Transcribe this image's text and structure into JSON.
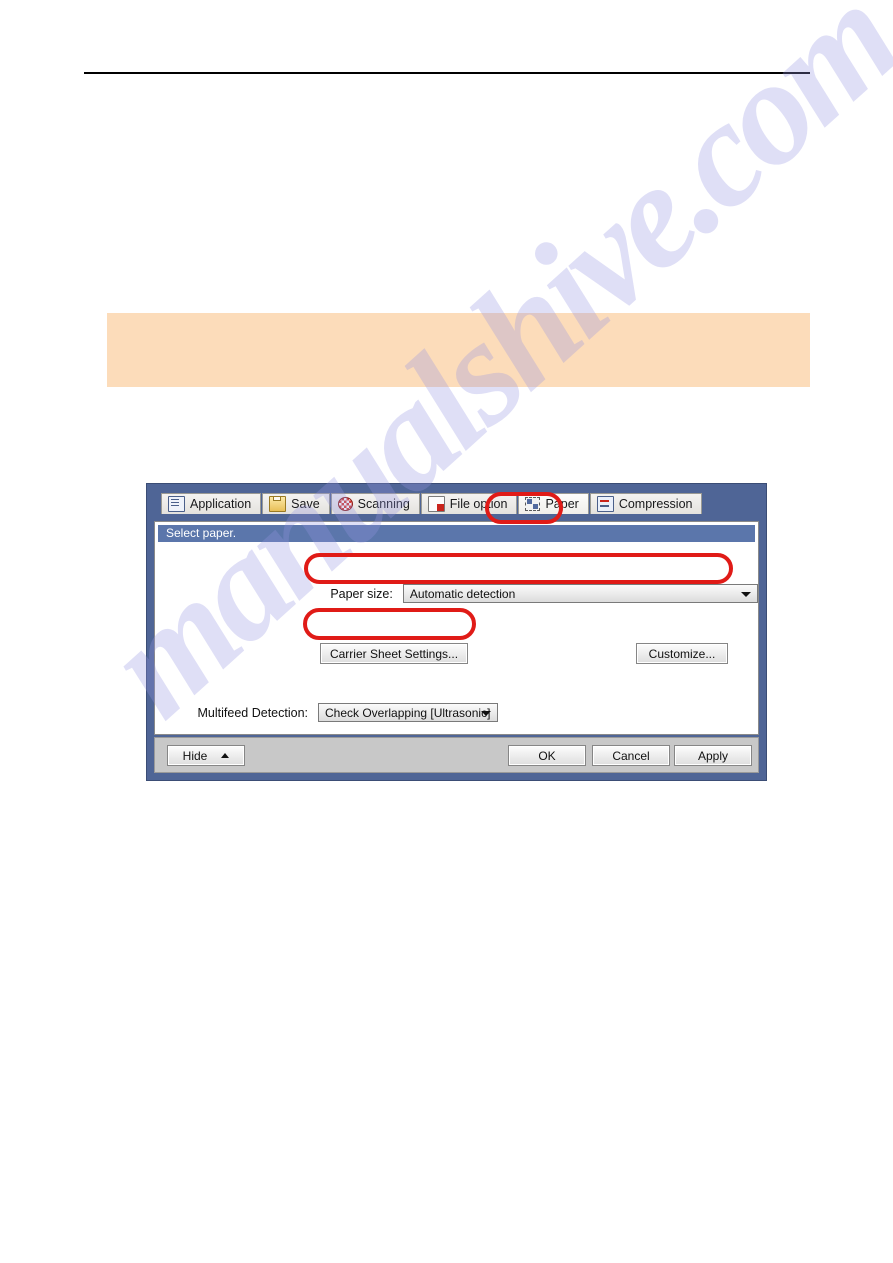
{
  "page": {
    "watermark": "manualshive.com",
    "header_rule": true,
    "callout": {
      "text": "",
      "background_color": "#fcdcba"
    }
  },
  "dialog": {
    "title_bar_color": "#4f6596",
    "tabs": [
      {
        "label": "Application",
        "icon": "application-window-icon",
        "active": false
      },
      {
        "label": "Save",
        "icon": "save-folder-icon",
        "active": false
      },
      {
        "label": "Scanning",
        "icon": "scanning-checker-icon",
        "active": false
      },
      {
        "label": "File option",
        "icon": "file-option-icon",
        "active": false
      },
      {
        "label": "Paper",
        "icon": "paper-crop-icon",
        "active": true
      },
      {
        "label": "Compression",
        "icon": "compression-icon",
        "active": false
      }
    ],
    "section_header": "Select paper.",
    "fields": {
      "paper_size": {
        "label": "Paper size:",
        "value": "Automatic detection"
      },
      "multifeed_detection": {
        "label": "Multifeed Detection:",
        "value": "Check Overlapping [Ultrasonic]"
      }
    },
    "buttons": {
      "carrier_sheet_settings": "Carrier Sheet Settings...",
      "customize": "Customize...",
      "hide": "Hide",
      "ok": "OK",
      "cancel": "Cancel",
      "apply": "Apply"
    }
  },
  "annotations": {
    "accent_color": "#e01b17",
    "highlighted": [
      "Paper tab",
      "Paper size dropdown",
      "Carrier Sheet Settings button"
    ]
  }
}
